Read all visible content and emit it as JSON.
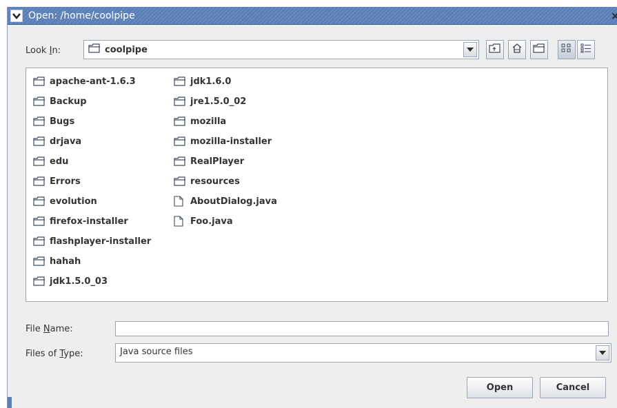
{
  "window": {
    "title": "Open: /home/coolpipe",
    "close_glyph": "×"
  },
  "look_in": {
    "label_pre": "Look ",
    "label_mnemonic": "I",
    "label_post": "n:",
    "value": "coolpipe"
  },
  "toolbar": {
    "buttons": [
      "up-one-level-icon",
      "home-icon",
      "new-folder-icon",
      "list-view-icon",
      "details-view-icon"
    ]
  },
  "files": {
    "column1": [
      {
        "name": "apache-ant-1.6.3",
        "type": "folder"
      },
      {
        "name": "Backup",
        "type": "folder"
      },
      {
        "name": "Bugs",
        "type": "folder"
      },
      {
        "name": "drjava",
        "type": "folder"
      },
      {
        "name": "edu",
        "type": "folder"
      },
      {
        "name": "Errors",
        "type": "folder"
      },
      {
        "name": "evolution",
        "type": "folder"
      },
      {
        "name": "firefox-installer",
        "type": "folder"
      },
      {
        "name": "flashplayer-installer",
        "type": "folder"
      },
      {
        "name": "hahah",
        "type": "folder"
      },
      {
        "name": "jdk1.5.0_03",
        "type": "folder"
      }
    ],
    "column2": [
      {
        "name": "jdk1.6.0",
        "type": "folder"
      },
      {
        "name": "jre1.5.0_02",
        "type": "folder"
      },
      {
        "name": "mozilla",
        "type": "folder"
      },
      {
        "name": "mozilla-installer",
        "type": "folder"
      },
      {
        "name": "RealPlayer",
        "type": "folder"
      },
      {
        "name": "resources",
        "type": "folder"
      },
      {
        "name": "AboutDialog.java",
        "type": "file"
      },
      {
        "name": "Foo.java",
        "type": "file"
      }
    ]
  },
  "file_name": {
    "label_pre": "File ",
    "label_mnemonic": "N",
    "label_post": "ame:",
    "value": ""
  },
  "file_type": {
    "label_pre": "Files of ",
    "label_mnemonic": "T",
    "label_post": "ype:",
    "value": "Java source files"
  },
  "buttons": {
    "open": "Open",
    "cancel": "Cancel"
  },
  "colors": {
    "titlebar": "#5a7fb8",
    "dialog_bg": "#eeeeee",
    "border": "#9aa5b3"
  }
}
